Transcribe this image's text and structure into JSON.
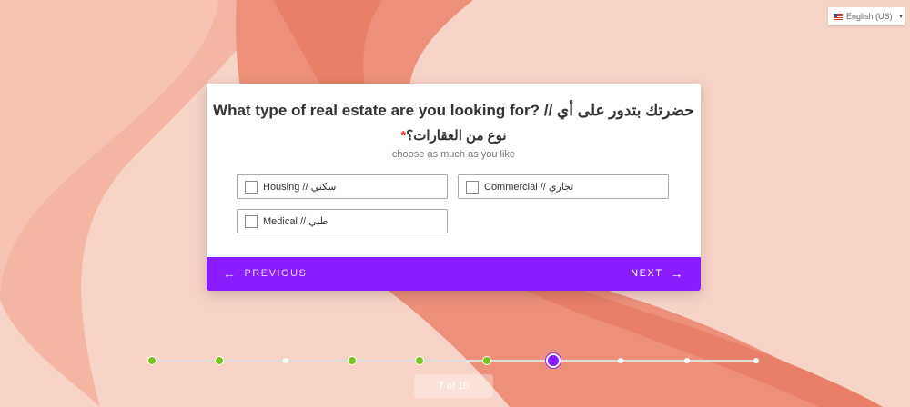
{
  "language": {
    "label": "English (US)",
    "flag_icon": "us-flag-icon"
  },
  "question": {
    "line1": "What type of real estate are you looking for? // حضرتك بتدور على أي",
    "line2": "نوع من العقارات؟",
    "required_mark": "*",
    "hint": "choose as much as you like"
  },
  "options": [
    {
      "label": "Housing // سكني",
      "checked": false
    },
    {
      "label": "Commercial // تجاري",
      "checked": false
    },
    {
      "label": "Medical // طبي",
      "checked": false
    }
  ],
  "nav": {
    "previous_label": "PREVIOUS",
    "next_label": "NEXT"
  },
  "progress": {
    "current": "7",
    "of": "of",
    "total": "10",
    "steps": [
      "done",
      "done",
      "pending",
      "done",
      "done",
      "done",
      "current",
      "pending",
      "pending",
      "pending"
    ]
  },
  "colors": {
    "accent": "#8b1cff",
    "done": "#7ac21e",
    "required": "#e0413a"
  }
}
